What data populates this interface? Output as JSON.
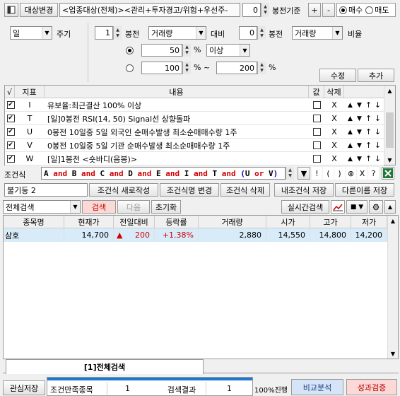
{
  "toolbar": {
    "target_change": "대상변경",
    "target_text": "<업종대상(전체)><관리+투자경고/위험+우선주-",
    "bong_value": "0",
    "bong_label": "봉전기준",
    "plus": "+",
    "minus": "-",
    "buy": "매수",
    "sell": "매도"
  },
  "condition_editor": {
    "period_select": "일",
    "period_label": "주기",
    "n1": "1",
    "bong1": "봉전",
    "metric1": "거래량",
    "compare": "대비",
    "n2": "0",
    "bong2": "봉전",
    "metric2": "거래량",
    "ratio": "비율",
    "val1": "50",
    "unit1": "%",
    "op": "이상",
    "val2": "100",
    "unit2": "% ~",
    "val3": "200",
    "unit3": "%",
    "modify": "수정",
    "add": "추가"
  },
  "condition_table": {
    "headers": {
      "check": "√",
      "index": "지표",
      "content": "내용",
      "value": "값",
      "delete": "삭제"
    },
    "rows": [
      {
        "letter": "I",
        "text": "유보율:최근결산 100% 이상",
        "del": "X"
      },
      {
        "letter": "T",
        "text": "[일]0봉전 RSI(14, 50) Signal선 상향돌파",
        "del": "X"
      },
      {
        "letter": "U",
        "text": "0봉전 10일중 5일 외국인 순매수발생 최소순매매수량 1주",
        "del": "X"
      },
      {
        "letter": "V",
        "text": "0봉전 10일중 5일 기관 순매수발생 최소순매매수량 1주",
        "del": "X"
      },
      {
        "letter": "W",
        "text": "[일]1봉전 <숏바디(음봉)>",
        "del": "X"
      }
    ]
  },
  "formula": {
    "label": "조건식",
    "tokens": [
      {
        "t": "A",
        "c": "#000000"
      },
      {
        "t": " and ",
        "c": "#d00000"
      },
      {
        "t": "B",
        "c": "#000000"
      },
      {
        "t": " and ",
        "c": "#d00000"
      },
      {
        "t": "C",
        "c": "#000000"
      },
      {
        "t": " and ",
        "c": "#d00000"
      },
      {
        "t": "D",
        "c": "#000000"
      },
      {
        "t": " and ",
        "c": "#d00000"
      },
      {
        "t": "E",
        "c": "#000000"
      },
      {
        "t": " and ",
        "c": "#d00000"
      },
      {
        "t": "I",
        "c": "#000000"
      },
      {
        "t": " and ",
        "c": "#d00000"
      },
      {
        "t": "T",
        "c": "#000000"
      },
      {
        "t": " and ",
        "c": "#d00000"
      },
      {
        "t": "(",
        "c": "#0000c0"
      },
      {
        "t": "U",
        "c": "#000000"
      },
      {
        "t": " or ",
        "c": "#d00000"
      },
      {
        "t": "V",
        "c": "#000000"
      },
      {
        "t": ")",
        "c": "#0000c0"
      }
    ],
    "ops": [
      "!",
      "(",
      ")",
      "⊗",
      "X",
      "?"
    ]
  },
  "save_bar": {
    "name": "불기둥 2",
    "new": "조건식 새로작성",
    "rename": "조건식명 변경",
    "delete": "조건식 삭제",
    "my_save": "내조건식 저장",
    "save_as": "다른이름 저장"
  },
  "search_bar": {
    "mode": "전체검색",
    "search": "검색",
    "next": "다음",
    "reset": "초기화",
    "realtime": "실시간검색"
  },
  "result_table": {
    "headers": [
      "종목명",
      "현재가",
      "전일대비",
      "등락률",
      "거래량",
      "시가",
      "고가",
      "저가"
    ],
    "rows": [
      {
        "name": "삼호",
        "price": "14,700",
        "arrow": "▲",
        "change": "200",
        "rate": "+1.38%",
        "volume": "2,880",
        "open": "14,550",
        "high": "14,800",
        "low": "14,200"
      }
    ]
  },
  "tab": {
    "label": "[1]전체검색"
  },
  "bottom": {
    "watch_save": "관심저장",
    "met_label": "조건만족종목",
    "met_value": "1",
    "result_label": "검색결과",
    "result_value": "1",
    "progress": "100%진행",
    "progress_pct": 100,
    "compare": "비교분석",
    "verify": "성과검증"
  },
  "colors": {
    "up": "#d40000",
    "selected_row": "#d8ebf8",
    "accent": "#1e78d2"
  }
}
